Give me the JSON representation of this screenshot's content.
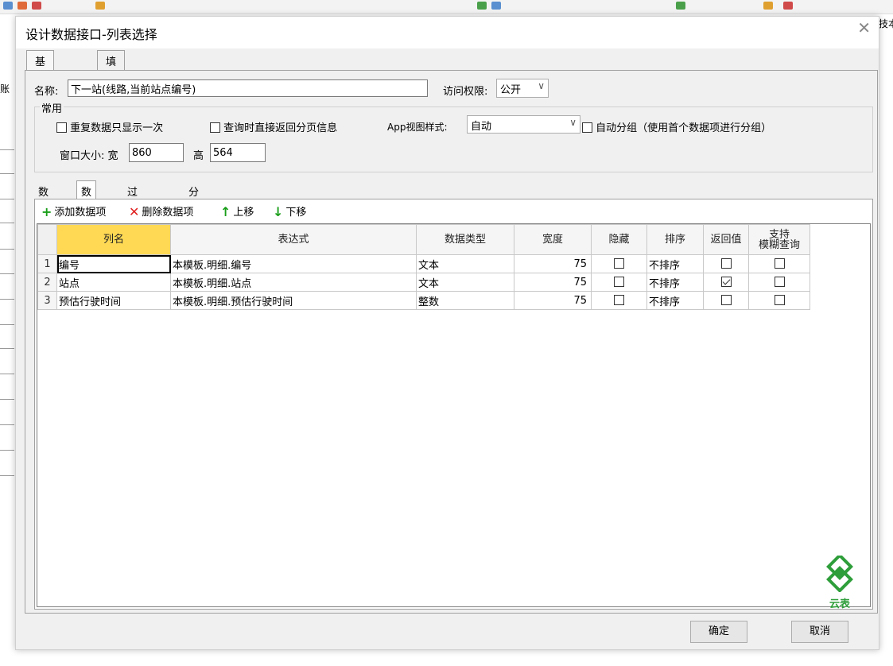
{
  "dialog": {
    "title": "设计数据接口-列表选择"
  },
  "main_tabs": [
    {
      "label": "基本设置",
      "active": true
    },
    {
      "label": "填表公式",
      "active": false
    }
  ],
  "form": {
    "name_label": "名称:",
    "name_value": "下一站(线路,当前站点编号)",
    "access_label": "访问权限:",
    "access_value": "公开"
  },
  "common": {
    "group_title": "常用",
    "repeat_once": {
      "label": "重复数据只显示一次",
      "checked": false
    },
    "return_paging": {
      "label": "查询时直接返回分页信息",
      "checked": false
    },
    "app_view_label": "App视图样式:",
    "app_view_value": "自动",
    "auto_group": {
      "label": "自动分组（使用首个数据项进行分组）",
      "checked": false
    },
    "window_size_label": "窗口大小: 宽",
    "width_value": "860",
    "height_label": "高",
    "height_value": "564"
  },
  "sub_tabs": [
    {
      "label": "数据源",
      "active": false
    },
    {
      "label": "数据列",
      "active": true
    },
    {
      "label": "过滤条件",
      "active": false
    },
    {
      "label": "分类树",
      "active": false
    }
  ],
  "toolbar": {
    "add": "添加数据项",
    "delete": "删除数据项",
    "up": "上移",
    "down": "下移"
  },
  "grid": {
    "headers": [
      "列名",
      "表达式",
      "数据类型",
      "宽度",
      "隐藏",
      "排序",
      "返回值",
      "支持",
      "模糊查询"
    ],
    "rows": [
      {
        "n": "1",
        "name": "编号",
        "expr": "本模板.明细.编号",
        "type": "文本",
        "width": "75",
        "hidden": false,
        "sort": "不排序",
        "ret": false,
        "fuzzy": false
      },
      {
        "n": "2",
        "name": "站点",
        "expr": "本模板.明细.站点",
        "type": "文本",
        "width": "75",
        "hidden": false,
        "sort": "不排序",
        "ret": true,
        "fuzzy": false
      },
      {
        "n": "3",
        "name": "预估行驶时间",
        "expr": "本模板.明细.预估行驶时间",
        "type": "整数",
        "width": "75",
        "hidden": false,
        "sort": "不排序",
        "ret": false,
        "fuzzy": false
      }
    ]
  },
  "logo_text": "云表",
  "buttons": {
    "ok": "确定",
    "cancel": "取消"
  },
  "bg": {
    "right_text": "技本",
    "left_text": "账"
  },
  "colors": {
    "header_highlight": "#ffd954",
    "add_icon": "#1a9e1a",
    "delete_icon": "#e02020",
    "logo": "#2e9e3a"
  }
}
